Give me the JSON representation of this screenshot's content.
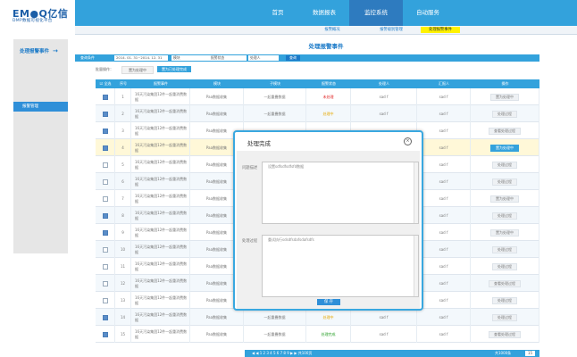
{
  "header": {
    "logo": "EM●Q亿信",
    "logo_sub": "DMP数据可视化平台"
  },
  "nav": {
    "items": [
      "首页",
      "数据报表",
      "监控系统",
      "自动服务"
    ],
    "active_index": 2
  },
  "subnav": {
    "items": [
      "报警概况",
      "报警级别管理",
      "处理报警事件"
    ],
    "active_index": 2
  },
  "sidebar": {
    "title": "处理报警事件",
    "arrow": "→",
    "item": "报警管理"
  },
  "page_title": "处理报警事件",
  "filter": {
    "label": "查询条件",
    "date_range": "2014. 01. 31~2014. 12. 31",
    "module_label": "模块",
    "status_label": "报警状态",
    "handler_label": "处理人",
    "query_btn": "查询"
  },
  "batch": {
    "label": "批量操作：",
    "btn1": "置为处理中",
    "btn2": "置为已处理完成"
  },
  "table": {
    "headers": [
      "全选",
      "序号",
      "报警事件",
      "模块",
      "子模块",
      "报警状态",
      "处理人",
      "汇报人",
      "操作"
    ],
    "rows": [
      {
        "no": "1",
        "checked": true,
        "event": "16天污染集团12件一起重消费数据",
        "module": "Paa数据收集",
        "submodule": "一起重叠数据",
        "status": "未处理",
        "status_color": "#e02020",
        "handler": "sad f",
        "reporter": "sad f",
        "action": "置为处理中"
      },
      {
        "no": "2",
        "checked": true,
        "event": "16天污染集团12件一起重消费数据",
        "module": "Paa数据收集",
        "submodule": "一起重叠数据",
        "status": "处理中",
        "status_color": "#e6a800",
        "handler": "sad f",
        "reporter": "sad f",
        "action": "处理过程"
      },
      {
        "no": "3",
        "checked": true,
        "event": "16天污染集团12件一起重消费数据",
        "module": "Paa数据收集",
        "submodule": "",
        "status": "",
        "status_color": "#777777",
        "handler": "",
        "reporter": "sad f",
        "action": "查看处理过程"
      },
      {
        "no": "4",
        "checked": true,
        "event": "16天污染集团12件一起重消费数据",
        "module": "Paa数据收集",
        "submodule": "",
        "status": "",
        "status_color": "#777777",
        "handler": "",
        "reporter": "sad f",
        "action": "置为处理中"
      },
      {
        "no": "5",
        "checked": false,
        "event": "16天污染集团12件一起重消费数据",
        "module": "Paa数据收集",
        "submodule": "",
        "status": "",
        "status_color": "#777777",
        "handler": "",
        "reporter": "sad f",
        "action": "处理过程"
      },
      {
        "no": "6",
        "checked": false,
        "event": "16天污染集团12件一起重消费数据",
        "module": "Paa数据收集",
        "submodule": "",
        "status": "",
        "status_color": "#777777",
        "handler": "",
        "reporter": "sad f",
        "action": "处理过程"
      },
      {
        "no": "7",
        "checked": false,
        "event": "16天污染集团12件一起重消费数据",
        "module": "Paa数据收集",
        "submodule": "",
        "status": "",
        "status_color": "#777777",
        "handler": "",
        "reporter": "sad f",
        "action": "置为处理中"
      },
      {
        "no": "8",
        "checked": true,
        "event": "16天污染集团12件一起重消费数据",
        "module": "Paa数据收集",
        "submodule": "",
        "status": "",
        "status_color": "#777777",
        "handler": "",
        "reporter": "sad f",
        "action": "处理过程"
      },
      {
        "no": "9",
        "checked": true,
        "event": "16天污染集团12件一起重消费数据",
        "module": "Paa数据收集",
        "submodule": "",
        "status": "",
        "status_color": "#777777",
        "handler": "",
        "reporter": "sad f",
        "action": "置为处理中"
      },
      {
        "no": "10",
        "checked": false,
        "event": "16天污染集团12件一起重消费数据",
        "module": "Paa数据收集",
        "submodule": "",
        "status": "",
        "status_color": "#777777",
        "handler": "",
        "reporter": "sad f",
        "action": "处理过程"
      },
      {
        "no": "11",
        "checked": false,
        "event": "16天污染集团12件一起重消费数据",
        "module": "Paa数据收集",
        "submodule": "",
        "status": "",
        "status_color": "#777777",
        "handler": "",
        "reporter": "sad f",
        "action": "处理过程"
      },
      {
        "no": "12",
        "checked": false,
        "event": "16天污染集团12件一起重消费数据",
        "module": "Paa数据收集",
        "submodule": "",
        "status": "",
        "status_color": "#777777",
        "handler": "",
        "reporter": "sad f",
        "action": "查看处理过程"
      },
      {
        "no": "13",
        "checked": false,
        "event": "16天污染集团12件一起重消费数据",
        "module": "Paa数据收集",
        "submodule": "",
        "status": "",
        "status_color": "#777777",
        "handler": "",
        "reporter": "sad f",
        "action": "处理过程"
      },
      {
        "no": "14",
        "checked": true,
        "event": "16天污染集团12件一起重消费数据",
        "module": "Paa数据收集",
        "submodule": "一起重叠数据",
        "status": "处理中",
        "status_color": "#e6a800",
        "handler": "sad f",
        "reporter": "sad f",
        "action": "处理过程"
      },
      {
        "no": "15",
        "checked": true,
        "event": "16天污染集团12件一起重消费数据",
        "module": "Paa数据收集",
        "submodule": "一起重叠数据",
        "status": "处理完成",
        "status_color": "#2aa02a",
        "handler": "sad f",
        "reporter": "sad f",
        "action": "查看处理过程"
      }
    ]
  },
  "pager": {
    "text": "◀  ◀  1  2  3  4  5  6  7  8  9  ▶  ▶  共100页",
    "total": "共1000条",
    "size": "15"
  },
  "modal": {
    "title": "处理完成",
    "close": "×",
    "desc_label": "问题描述",
    "desc_value": "设置sdfsdfsdfsfd数据",
    "process_label": "处理过程",
    "process_value": "重试执行sdsdfsdafsdafsdfs",
    "save_btn": "保  存"
  },
  "colors": {
    "accent": "#33a2dc",
    "active_nav": "#2e7bbf",
    "highlight": "#fff200",
    "row_highlight": "#fff8d8"
  }
}
